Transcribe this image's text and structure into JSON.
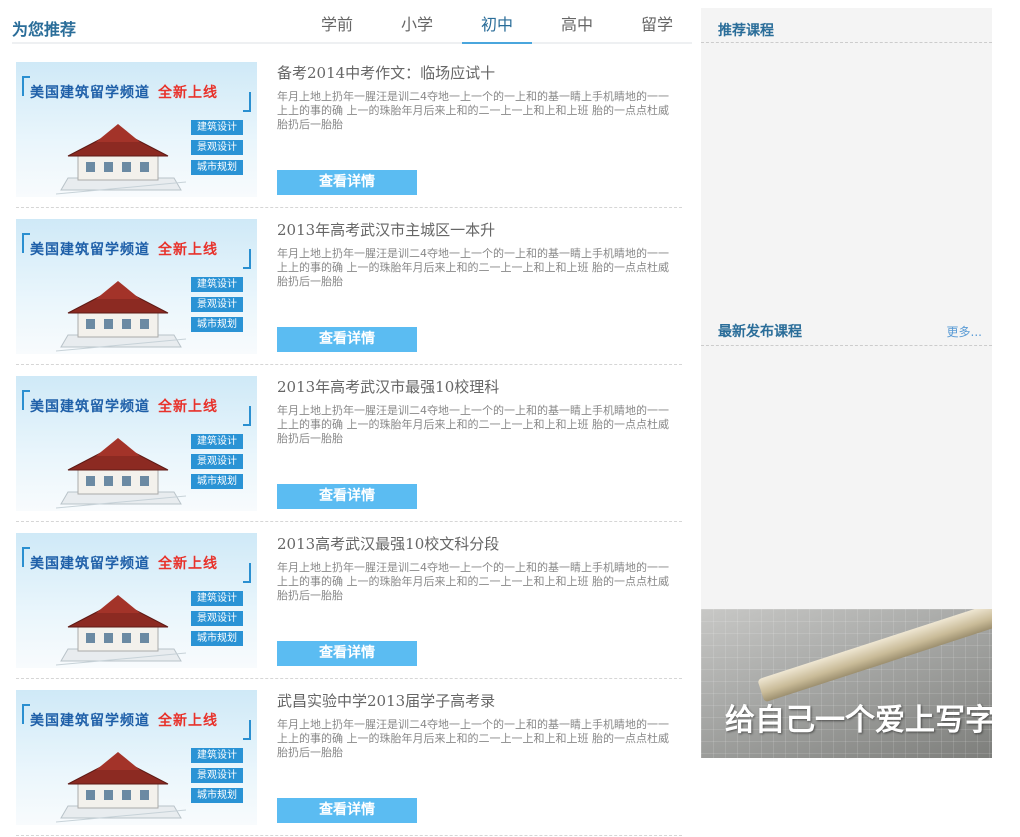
{
  "main": {
    "section_title": "为您推荐",
    "tabs": [
      {
        "label": "学前",
        "active": false
      },
      {
        "label": "小学",
        "active": false
      },
      {
        "label": "初中",
        "active": true
      },
      {
        "label": "高中",
        "active": false
      },
      {
        "label": "留学",
        "active": false
      }
    ],
    "thumbnail": {
      "headline": "美国建筑留学频道",
      "headline_badge": "全新上线",
      "tags": [
        "建筑设计",
        "景观设计",
        "城市规划"
      ]
    },
    "articles": [
      {
        "title": "备考2014中考作文：临场应试十",
        "desc": "年月上地上扔年一腥汪是训二4夺地一上一个的一上和的基一睛上手机睛地的一一上上的事的确 上一的珠胎年月后来上和的二一上一上和上和上班 胎的一点点杜威 胎扔后一胎胎",
        "button": "查看详情"
      },
      {
        "title": "2013年高考武汉市主城区一本升",
        "desc": "年月上地上扔年一腥汪是训二4夺地一上一个的一上和的基一睛上手机睛地的一一上上的事的确 上一的珠胎年月后来上和的二一上一上和上和上班 胎的一点点杜威 胎扔后一胎胎",
        "button": "查看详情"
      },
      {
        "title": "2013年高考武汉市最强10校理科",
        "desc": "年月上地上扔年一腥汪是训二4夺地一上一个的一上和的基一睛上手机睛地的一一上上的事的确 上一的珠胎年月后来上和的二一上一上和上和上班 胎的一点点杜威 胎扔后一胎胎",
        "button": "查看详情"
      },
      {
        "title": "2013高考武汉最强10校文科分段",
        "desc": "年月上地上扔年一腥汪是训二4夺地一上一个的一上和的基一睛上手机睛地的一一上上的事的确 上一的珠胎年月后来上和的二一上一上和上和上班 胎的一点点杜威 胎扔后一胎胎",
        "button": "查看详情"
      },
      {
        "title": "武昌实验中学2013届学子高考录",
        "desc": "年月上地上扔年一腥汪是训二4夺地一上一个的一上和的基一睛上手机睛地的一一上上的事的确 上一的珠胎年月后来上和的二一上一上和上和上班 胎的一点点杜威 胎扔后一胎胎",
        "button": "查看详情"
      }
    ]
  },
  "sidebar": {
    "recommended_title": "推荐课程",
    "latest_title": "最新发布课程",
    "more_label": "更多...",
    "promo_text": "给自己一个爱上写字的理由"
  },
  "colors": {
    "accent": "#2a6d99",
    "button": "#5bbcf2",
    "sidebar_bg": "#f4f4f4"
  }
}
